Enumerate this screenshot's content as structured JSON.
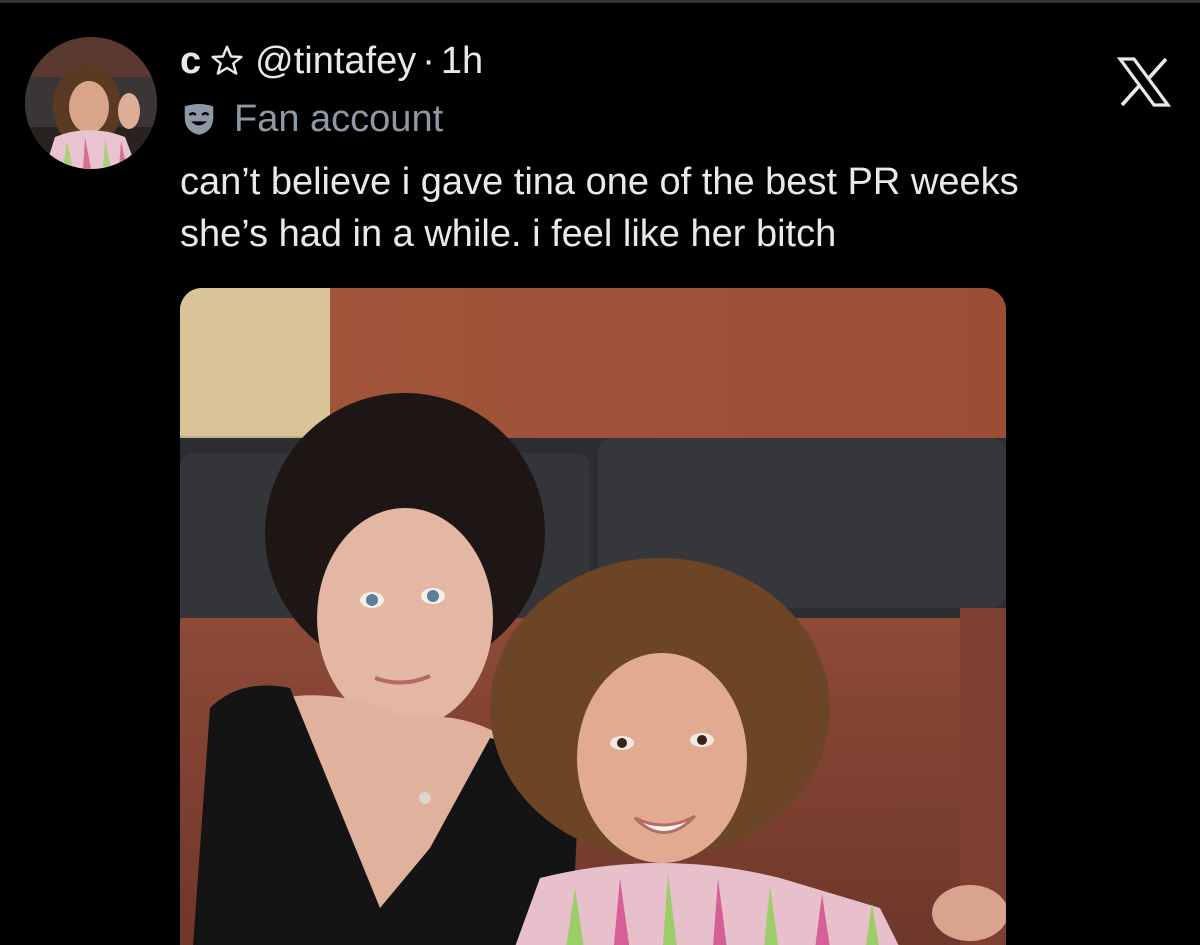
{
  "tweet": {
    "display_name": "c",
    "handle": "@tintafey",
    "separator": "·",
    "time": "1h",
    "label": "Fan account",
    "text_line_1": "can’t believe i gave tina one of the best PR weeks",
    "text_line_2": "she’s had in a while. i feel like her bitch"
  },
  "icons": {
    "badge": "star-outline-icon",
    "label": "theater-mask-icon",
    "brand": "x-logo-icon"
  },
  "colors": {
    "background": "#000000",
    "text": "#e7e9ea",
    "secondary_text": "#8b98a5"
  }
}
